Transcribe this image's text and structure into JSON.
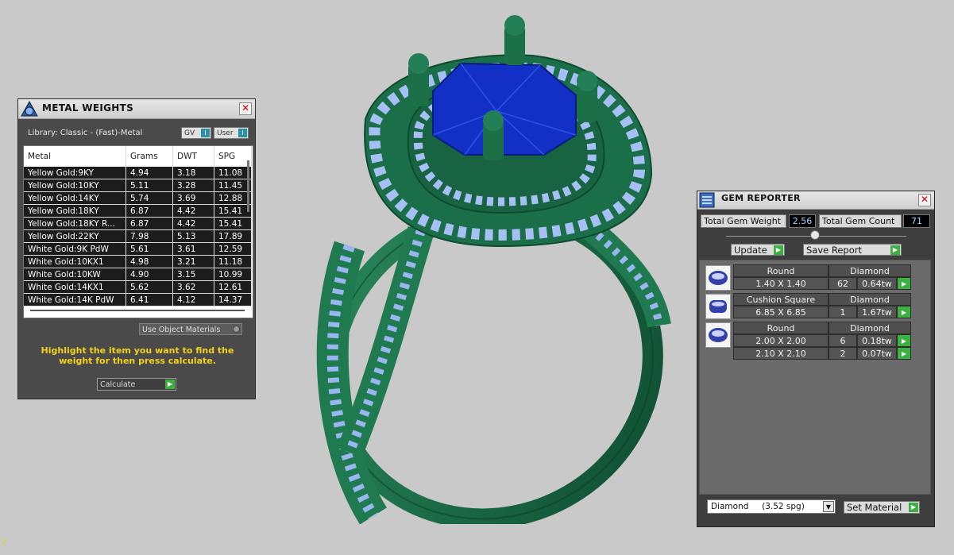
{
  "metal_weights": {
    "title": "METAL WEIGHTS",
    "library": "Library: Classic - (Fast)-Metal",
    "toggle_gv": "GV",
    "toggle_user": "User",
    "columns": [
      "Metal",
      "Grams",
      "DWT",
      "SPG"
    ],
    "rows": [
      [
        "Yellow Gold:9KY",
        "4.94",
        "3.18",
        "11.08"
      ],
      [
        "Yellow Gold:10KY",
        "5.11",
        "3.28",
        "11.45"
      ],
      [
        "Yellow Gold:14KY",
        "5.74",
        "3.69",
        "12.88"
      ],
      [
        "Yellow Gold:18KY",
        "6.87",
        "4.42",
        "15.41"
      ],
      [
        "Yellow Gold:18KY R...",
        "6.87",
        "4.42",
        "15.41"
      ],
      [
        "Yellow Gold:22KY",
        "7.98",
        "5.13",
        "17.89"
      ],
      [
        "White Gold:9K PdW",
        "5.61",
        "3.61",
        "12.59"
      ],
      [
        "White Gold:10KX1",
        "4.98",
        "3.21",
        "11.18"
      ],
      [
        "White Gold:10KW",
        "4.90",
        "3.15",
        "10.99"
      ],
      [
        "White Gold:14KX1",
        "5.62",
        "3.62",
        "12.61"
      ],
      [
        "White Gold:14K PdW",
        "6.41",
        "4.12",
        "14.37"
      ]
    ],
    "use_object_materials": "Use Object Materials",
    "hint": "Highlight the item you want to find the weight for then press calculate.",
    "calculate": "Calculate"
  },
  "gem_reporter": {
    "title": "GEM REPORTER",
    "total_weight_label": "Total Gem Weight",
    "total_weight_value": "2.56",
    "total_count_label": "Total Gem Count",
    "total_count_value": "71",
    "update": "Update",
    "save_report": "Save Report",
    "groups": [
      {
        "shape": "Round",
        "material": "Diamond",
        "sizes": [
          {
            "size": "1.40 X 1.40",
            "count": "62",
            "tw": "0.64tw"
          }
        ]
      },
      {
        "shape": "Cushion Square",
        "material": "Diamond",
        "sizes": [
          {
            "size": "6.85 X 6.85",
            "count": "1",
            "tw": "1.67tw"
          }
        ]
      },
      {
        "shape": "Round",
        "material": "Diamond",
        "sizes": [
          {
            "size": "2.00 X 2.00",
            "count": "6",
            "tw": "0.18tw"
          },
          {
            "size": "2.10 X 2.10",
            "count": "2",
            "tw": "0.07tw"
          }
        ]
      }
    ],
    "material_select": "Diamond     (3.52 spg)",
    "set_material": "Set Material"
  },
  "axis_mark": "z",
  "colors": {
    "metal": "#1e6b47",
    "center_stone": "#1030c8",
    "accent_stones": "#8fb0f0"
  }
}
